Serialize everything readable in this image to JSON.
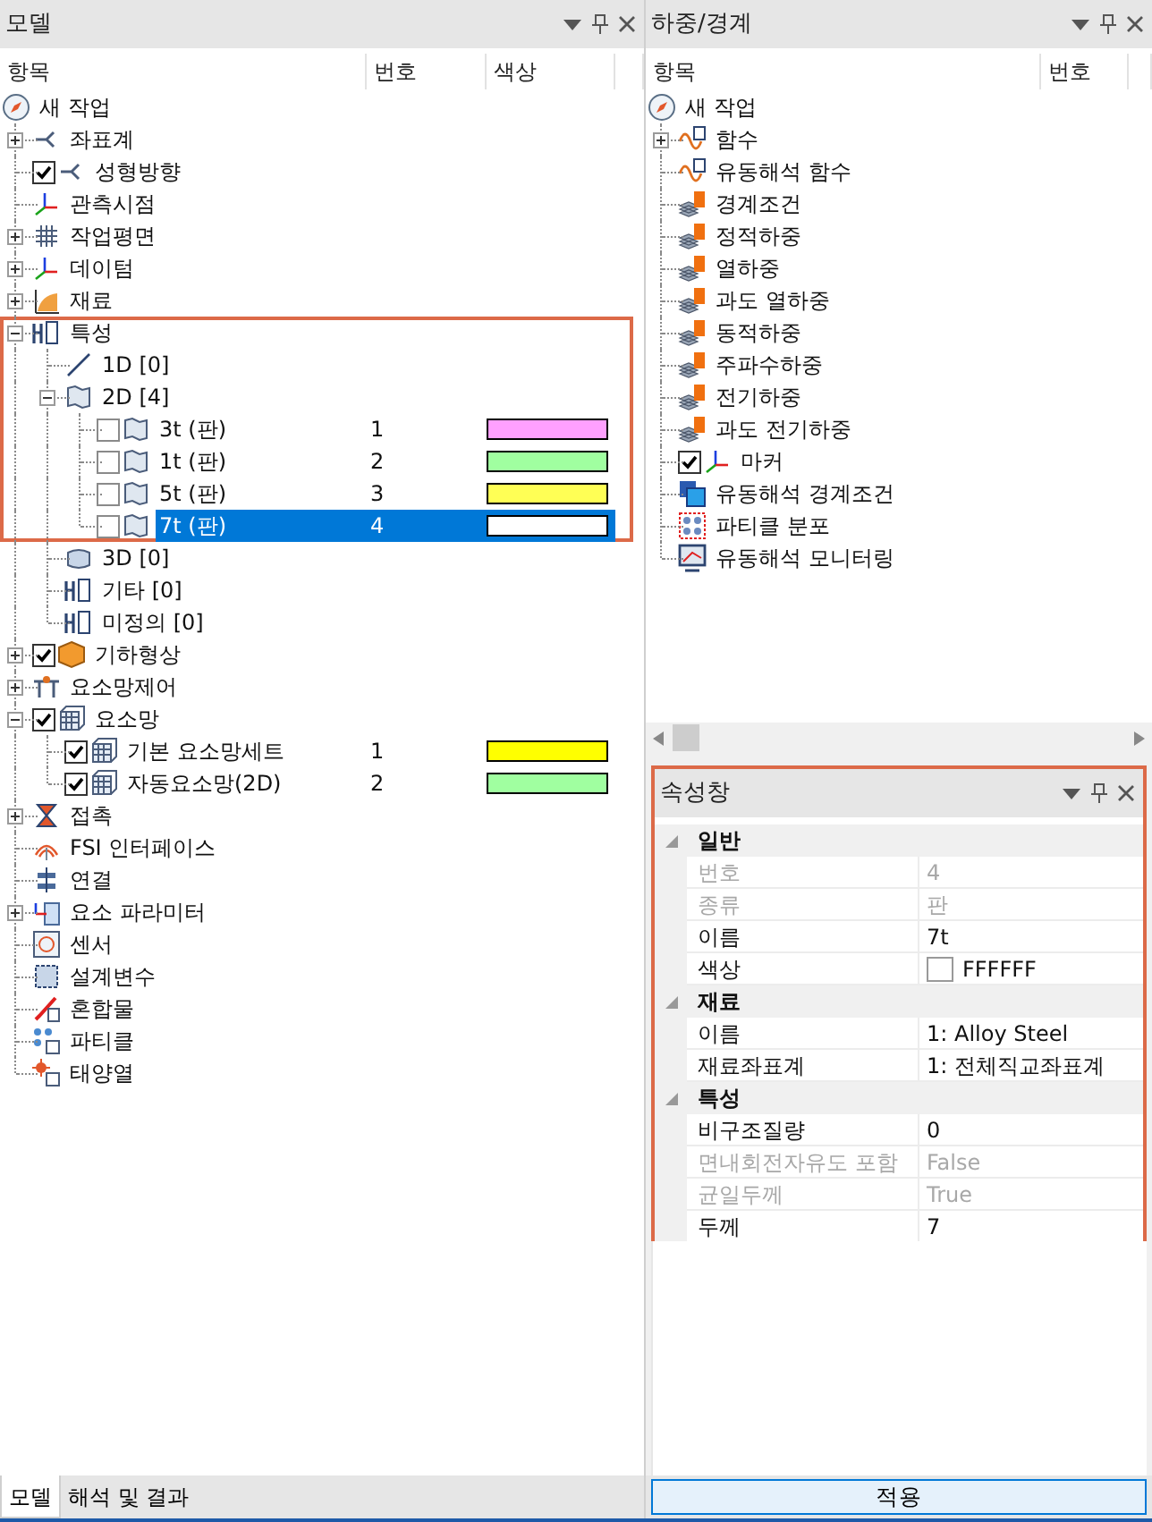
{
  "model_panel": {
    "title": "모델",
    "columns": [
      "항목",
      "번호",
      "색상"
    ],
    "tree": {
      "label": "새 작업",
      "selected": false,
      "children": [
        {
          "label": "좌표계",
          "selected": false,
          "expanded": false
        },
        {
          "label": "성형방향",
          "selected": false,
          "checked": true
        },
        {
          "label": "관측시점",
          "selected": false
        },
        {
          "label": "작업평면",
          "selected": false,
          "expanded": false
        },
        {
          "label": "데이텀",
          "selected": false,
          "expanded": false
        },
        {
          "label": "재료",
          "selected": false,
          "expanded": false
        },
        {
          "label": "특성",
          "selected": false,
          "expanded": true,
          "annotated": true,
          "children": [
            {
              "label": "1D [0]",
              "selected": false,
              "annotated": true
            },
            {
              "label": "2D [4]",
              "selected": false,
              "expanded": true,
              "annotated": true,
              "children": [
                {
                  "label": "3t (판)",
                  "selected": false,
                  "checked": false,
                  "number": "1",
                  "color": "#ffa0ff",
                  "annotated": true
                },
                {
                  "label": "1t (판)",
                  "selected": false,
                  "checked": false,
                  "number": "2",
                  "color": "#a0ffa0",
                  "annotated": true
                },
                {
                  "label": "5t (판)",
                  "selected": false,
                  "checked": false,
                  "number": "3",
                  "color": "#ffff55",
                  "annotated": true
                },
                {
                  "label": "7t (판)",
                  "selected": true,
                  "checked": false,
                  "number": "4",
                  "color": "#ffffff",
                  "annotated": true
                }
              ]
            },
            {
              "label": "3D [0]",
              "selected": false
            },
            {
              "label": "기타 [0]",
              "selected": false
            },
            {
              "label": "미정의 [0]",
              "selected": false
            }
          ]
        },
        {
          "label": "기하형상",
          "selected": false,
          "expanded": false,
          "checked": true
        },
        {
          "label": "요소망제어",
          "selected": false,
          "expanded": false
        },
        {
          "label": "요소망",
          "selected": false,
          "expanded": true,
          "checked": true,
          "children": [
            {
              "label": "기본 요소망세트",
              "selected": false,
              "checked": true,
              "number": "1",
              "color": "#ffff00"
            },
            {
              "label": "자동요소망(2D)",
              "selected": false,
              "checked": true,
              "number": "2",
              "color": "#a0ffa0"
            }
          ]
        },
        {
          "label": "접촉",
          "selected": false,
          "expanded": false
        },
        {
          "label": "FSI 인터페이스",
          "selected": false
        },
        {
          "label": "연결",
          "selected": false
        },
        {
          "label": "요소 파라미터",
          "selected": false,
          "expanded": false
        },
        {
          "label": "센서",
          "selected": false
        },
        {
          "label": "설계변수",
          "selected": false
        },
        {
          "label": "혼합물",
          "selected": false
        },
        {
          "label": "파티클",
          "selected": false
        },
        {
          "label": "태양열",
          "selected": false
        }
      ]
    }
  },
  "load_panel": {
    "title": "하중/경계",
    "columns": [
      "항목",
      "번호"
    ],
    "tree": {
      "label": "새 작업",
      "selected": false,
      "children": [
        {
          "label": "함수",
          "selected": false,
          "expanded": false
        },
        {
          "label": "유동해석 함수",
          "selected": false
        },
        {
          "label": "경계조건",
          "selected": false
        },
        {
          "label": "정적하중",
          "selected": false
        },
        {
          "label": "열하중",
          "selected": false
        },
        {
          "label": "과도 열하중",
          "selected": false
        },
        {
          "label": "동적하중",
          "selected": false
        },
        {
          "label": "주파수하중",
          "selected": false
        },
        {
          "label": "전기하중",
          "selected": false
        },
        {
          "label": "과도 전기하중",
          "selected": false
        },
        {
          "label": "마커",
          "selected": false,
          "checked": true
        },
        {
          "label": "유동해석 경계조건",
          "selected": false
        },
        {
          "label": "파티클 분포",
          "selected": false
        },
        {
          "label": "유동해석 모니터링",
          "selected": false
        }
      ]
    }
  },
  "properties_panel": {
    "title": "속성창",
    "annotated": true,
    "categories": [
      {
        "name": "일반",
        "expanded": true,
        "rows": [
          {
            "name": "번호",
            "value": "4",
            "disabled": true
          },
          {
            "name": "종류",
            "value": "판",
            "disabled": true
          },
          {
            "name": "이름",
            "value": "7t",
            "disabled": false
          },
          {
            "name": "색상",
            "value": "FFFFFF",
            "disabled": false,
            "color": "#ffffff"
          }
        ]
      },
      {
        "name": "재료",
        "expanded": true,
        "rows": [
          {
            "name": "이름",
            "value": "1: Alloy Steel",
            "disabled": false
          },
          {
            "name": "재료좌표계",
            "value": "1: 전체직교좌표계",
            "disabled": false
          }
        ]
      },
      {
        "name": "특성",
        "expanded": true,
        "rows": [
          {
            "name": "비구조질량",
            "value": "0",
            "disabled": false
          },
          {
            "name": "면내회전자유도 포함",
            "value": "False",
            "disabled": true
          },
          {
            "name": "균일두께",
            "value": "True",
            "disabled": true
          },
          {
            "name": "두께",
            "value": "7",
            "disabled": false
          }
        ]
      }
    ]
  },
  "bottom_tabs": [
    {
      "label": "모델",
      "selected": true
    },
    {
      "label": "해석 및 결과",
      "selected": false
    }
  ],
  "apply_button": "적용"
}
